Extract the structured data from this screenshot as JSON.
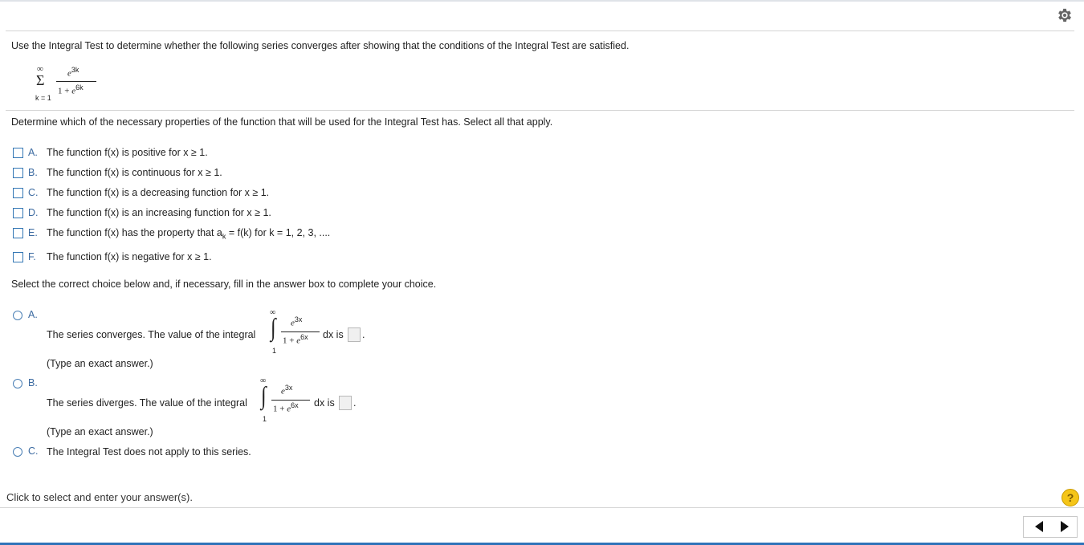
{
  "question": "Use the Integral Test to determine whether the following series converges after showing that the conditions of the Integral Test are satisfied.",
  "series": {
    "sigma": "Σ",
    "upper": "∞",
    "lower": "k = 1",
    "num_base": "e",
    "num_exp": "3k",
    "den_prefix": "1 + ",
    "den_base": "e",
    "den_exp": "6k"
  },
  "part1": {
    "prompt": "Determine which of the necessary properties of the function that will be used for the Integral Test has. Select all that apply.",
    "options": [
      {
        "letter": "A.",
        "text": "The function f(x) is positive for x ≥ 1."
      },
      {
        "letter": "B.",
        "text": "The function f(x) is continuous for x ≥ 1."
      },
      {
        "letter": "C.",
        "text": "The function f(x) is a decreasing function for x ≥ 1."
      },
      {
        "letter": "D.",
        "text": "The function f(x) is an increasing function for x ≥ 1."
      },
      {
        "letter": "E.",
        "text_before": "The function f(x) has the property that a",
        "subscript": "k",
        "text_after": " = f(k) for k = 1, 2, 3, ...."
      },
      {
        "letter": "F.",
        "text": "The function f(x) is negative for x ≥ 1."
      }
    ]
  },
  "part2": {
    "prompt": "Select the correct choice below and, if necessary, fill in the answer box to complete your choice.",
    "integral": {
      "upper": "∞",
      "lower": "1",
      "sign": "∫",
      "num_base": "e",
      "num_exp": "3x",
      "den_prefix": "1 + ",
      "den_base": "e",
      "den_exp": "6x",
      "dx_is": "dx is",
      "period": "."
    },
    "choices": [
      {
        "letter": "A.",
        "text": "The series converges. The value of the integral",
        "hint": "(Type an exact answer.)"
      },
      {
        "letter": "B.",
        "text": "The series diverges. The value of the integral",
        "hint": "(Type an exact answer.)"
      },
      {
        "letter": "C.",
        "text": "The Integral Test does not apply to this series."
      }
    ]
  },
  "footer": {
    "status": "Click to select and enter your answer(s).",
    "help": "?"
  },
  "icons": [
    "gear-icon",
    "help-icon",
    "previous-arrow-icon",
    "next-arrow-icon"
  ],
  "colors": {
    "accent": "#2f73b9",
    "letter": "#3b6aa0",
    "help": "#f5c518"
  }
}
